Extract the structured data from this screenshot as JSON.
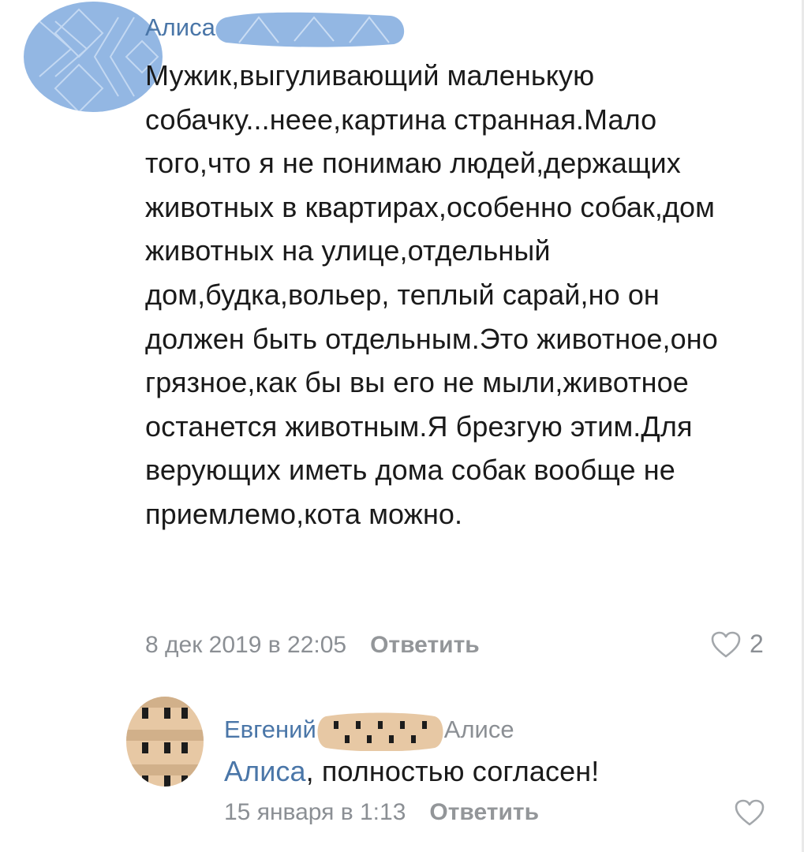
{
  "colors": {
    "link": "#4a76a8",
    "text": "#1a1a1a",
    "meta": "#8b8f94",
    "avatar_blur": "#93b7e3",
    "avatar_pixel": "#e7c8a4"
  },
  "comments": [
    {
      "author": "Алиса",
      "reply_to": "",
      "text": "Мужик,выгуливающий маленькую собачку...неее,картина странная.Мало того,что я не понимаю людей,держащих животных в квартирах,особенно собак,дом животных на улице,отдельный дом,будка,вольер, теплый сарай,но он должен быть отдельным.Это животное,оно грязное,как бы вы его не мыли,животное останется животным.Я брезгую этим.Для верующих иметь дома собак вообще не приемлемо,кота можно.",
      "date": "8 дек 2019 в 22:05",
      "reply_label": "Ответить",
      "likes": "2",
      "like_icon": "heart-outline-icon"
    },
    {
      "author": "Евгений",
      "reply_to": "Алисе",
      "mention": "Алиса",
      "text": ", полностью согласен!",
      "date": "15 января в 1:13",
      "reply_label": "Ответить",
      "like_icon": "heart-outline-icon"
    }
  ]
}
